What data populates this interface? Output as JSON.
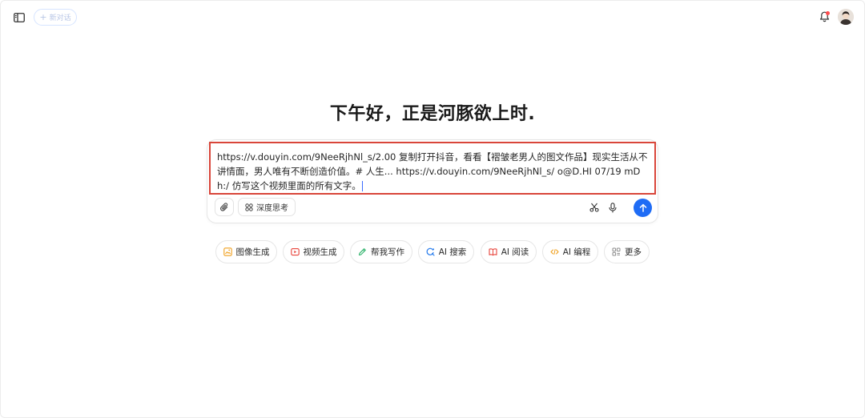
{
  "header": {
    "new_chat_label": "新对话"
  },
  "greeting": "下午好，正是河豚欲上时.",
  "composer": {
    "text": "https://v.douyin.com/9NeeRjhNl_s/2.00 复制打开抖音，看看【褶皱老男人的图文作品】现实生活从不讲情面，男人唯有不断创造价值。# 人生... https://v.douyin.com/9NeeRjhNl_s/ o@D.HI 07/19 mDh:/ 仿写这个视频里面的所有文字。",
    "deep_think_label": "深度思考"
  },
  "quick_actions": [
    {
      "label": "图像生成",
      "icon": "image-gen-icon",
      "color": "#f0a01e"
    },
    {
      "label": "视频生成",
      "icon": "video-gen-icon",
      "color": "#e8453c"
    },
    {
      "label": "帮我写作",
      "icon": "pen-icon",
      "color": "#2fb36b"
    },
    {
      "label": "AI 搜索",
      "icon": "search-icon",
      "color": "#2f80ed"
    },
    {
      "label": "AI 阅读",
      "icon": "book-icon",
      "color": "#e8453c"
    },
    {
      "label": "AI 编程",
      "icon": "code-icon",
      "color": "#f0a01e"
    },
    {
      "label": "更多",
      "icon": "grid-icon",
      "color": "#8c8c8c"
    }
  ],
  "colors": {
    "accent": "#1f6cf5",
    "highlight_border": "#d9463a"
  }
}
